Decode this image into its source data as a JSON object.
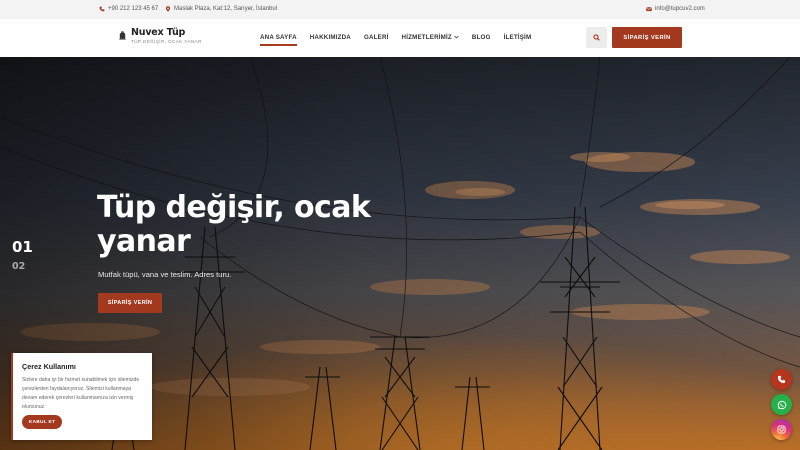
{
  "topbar": {
    "phone": "+90 212 123 45 67",
    "address": "Maslak Plaza, Kat:12, Sarıyer, İstanbul",
    "email": "info@tupcuv2.com"
  },
  "header": {
    "brand_name": "Nuvex Tüp",
    "brand_tagline": "TÜP DEĞİŞİR, OCAK YANAR",
    "nav": [
      {
        "label": "ANA SAYFA",
        "active": true
      },
      {
        "label": "HAKKIMIZDA"
      },
      {
        "label": "GALERİ"
      },
      {
        "label": "HİZMETLERİMİZ"
      },
      {
        "label": "BLOG"
      },
      {
        "label": "İLETİŞİM"
      }
    ],
    "order_button": "SİPARİŞ VERİN"
  },
  "hero": {
    "slides": [
      "01",
      "02"
    ],
    "title": "Tüp değişir, ocak yanar",
    "subtitle": "Mutfak tüpü, vana ve teslim. Adres turu.",
    "button": "SİPARİŞ VERİN"
  },
  "cookie": {
    "title": "Çerez Kullanımı",
    "text": "Sizlere daha iyi bir hizmet sunabilmek için sitemizde çerezlerden faydalanıyoruz. Sitemizi kullanmaya devam ederek çerezleri kullanmamıza izin vermiş olursunuz.",
    "button": "KABUL ET"
  },
  "floating": [
    "phone-icon",
    "whatsapp-icon",
    "instagram-icon"
  ],
  "colors": {
    "accent": "#a33a1f",
    "whatsapp": "#25b14a"
  }
}
